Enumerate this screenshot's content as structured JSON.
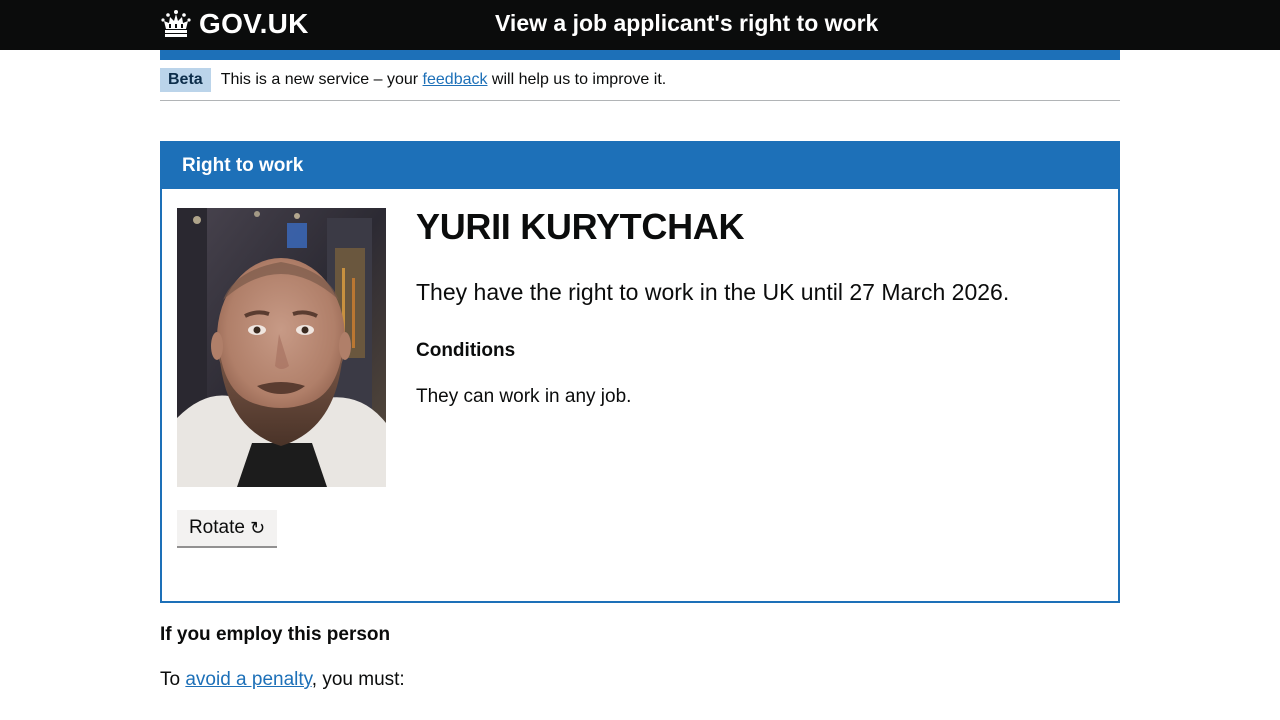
{
  "header": {
    "logo_text": "GOV.UK",
    "service_name": "View a job applicant's right to work"
  },
  "phase_banner": {
    "tag": "Beta",
    "text_before": "This is a new service – your ",
    "link_text": "feedback",
    "text_after": " will help us to improve it."
  },
  "panel": {
    "title": "Right to work",
    "person_name": "YURII KURYTCHAK",
    "status_text": "They have the right to work in the UK until 27 March 2026.",
    "conditions_heading": "Conditions",
    "conditions_text": "They can work in any job.",
    "photo_alt": "Photo of the job applicant",
    "rotate_label": "Rotate",
    "rotate_icon": "↻"
  },
  "employ_section": {
    "heading": "If you employ this person",
    "penalty_before": "To ",
    "penalty_link": "avoid a penalty",
    "penalty_after": ", you must:"
  },
  "colors": {
    "header_bg": "#0b0c0c",
    "brand_blue": "#1d70b8",
    "beta_tag_bg": "#bbd4ea",
    "button_bg": "#f3f2f1"
  },
  "icons": {
    "logo": "crown-icon",
    "rotate": "rotate-clockwise-icon"
  }
}
